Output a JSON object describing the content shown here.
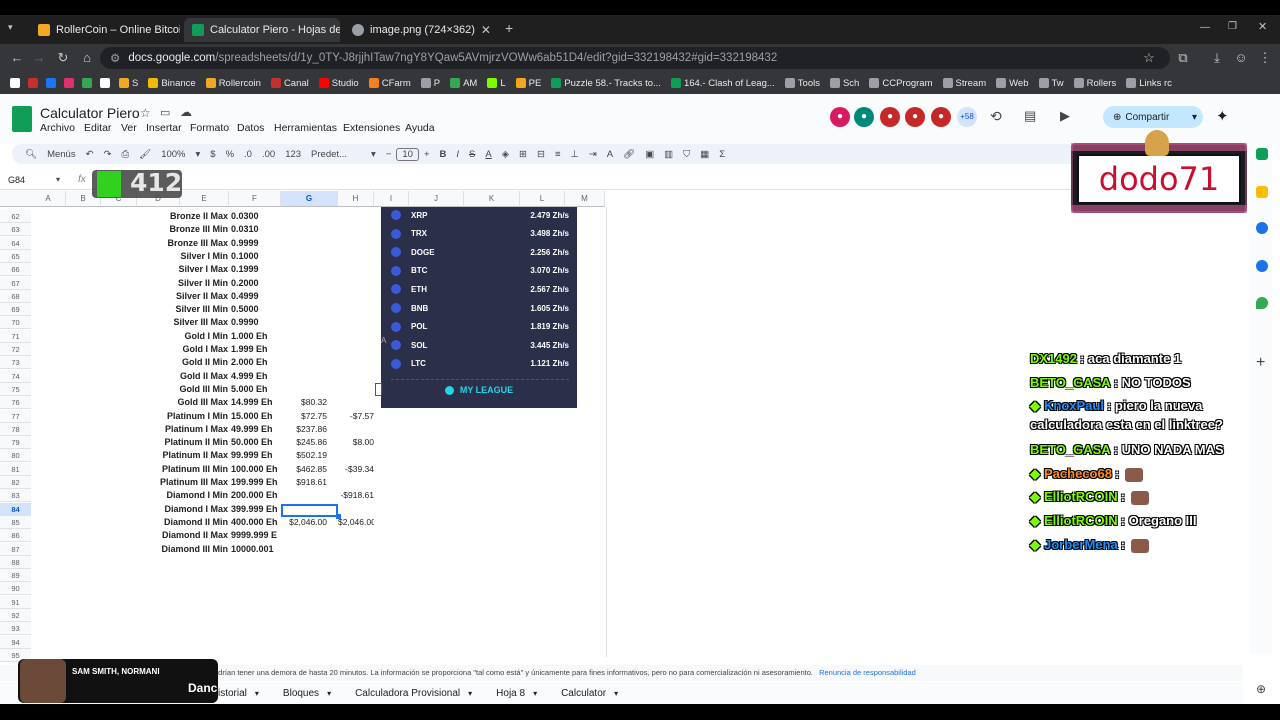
{
  "browser": {
    "tabs": [
      {
        "title": "RollerCoin – Online Bitcoin Mi",
        "color": "#f5a623"
      },
      {
        "title": "Calculator Piero - Hojas de cálc",
        "color": "#0f9d58"
      },
      {
        "title": "image.png (724×362)",
        "color": "#9aa0a6"
      }
    ],
    "url_main": "docs.google.com",
    "url_rest": "/spreadsheets/d/1y_0TY-J8rjjhITaw7ngY8YQaw5AVmjrzVOWw6ab51D4/edit?gid=332198432#gid=332198432",
    "bookmarks": [
      "S",
      "Binance",
      "Rollercoin",
      "Canal",
      "Studio",
      "CFarm",
      "P",
      "AM",
      "L",
      "PE",
      "Puzzle 58.- Tracks to...",
      "164.- Clash of Leag...",
      "Tools",
      "Sch",
      "CCProgram",
      "Stream",
      "Web",
      "Tw",
      "Rollers",
      "Links rc"
    ]
  },
  "sheets": {
    "title": "Calculator Piero",
    "menu": [
      "Archivo",
      "Editar",
      "Ver",
      "Insertar",
      "Formato",
      "Datos",
      "Herramientas",
      "Extensiones",
      "Ayuda"
    ],
    "toolbar": {
      "search": "Menús",
      "zoom": "100%",
      "currency": "$",
      "percent": "%",
      "dec_less": ".0",
      "dec_more": ".00",
      "num": "123",
      "font": "Predet...",
      "size": "10"
    },
    "namebox": "G84",
    "fx": "fx",
    "share": "Compartir",
    "collab_extra": "+58",
    "columns": [
      "A",
      "B",
      "C",
      "D",
      "E",
      "F",
      "G",
      "H",
      "I",
      "J",
      "K",
      "L",
      "M"
    ],
    "rows": [
      {
        "n": "62",
        "e": "Bronze II Max",
        "f": "0.0300",
        "g": "",
        "h": ""
      },
      {
        "n": "63",
        "e": "Bronze III Min",
        "f": "0.0310",
        "g": "",
        "h": ""
      },
      {
        "n": "64",
        "e": "Bronze III Max",
        "f": "0.9999",
        "g": "",
        "h": ""
      },
      {
        "n": "65",
        "e": "Silver I Min",
        "f": "0.1000",
        "g": "",
        "h": ""
      },
      {
        "n": "66",
        "e": "Silver I Max",
        "f": "0.1999",
        "g": "",
        "h": ""
      },
      {
        "n": "67",
        "e": "Silver II Min",
        "f": "0.2000",
        "g": "",
        "h": ""
      },
      {
        "n": "68",
        "e": "Silver II Max",
        "f": "0.4999",
        "g": "",
        "h": ""
      },
      {
        "n": "69",
        "e": "Silver III Min",
        "f": "0.5000",
        "g": "",
        "h": ""
      },
      {
        "n": "70",
        "e": "Silver III Max",
        "f": "0.9990",
        "g": "",
        "h": ""
      },
      {
        "n": "71",
        "e": "Gold I Min",
        "f": "1.000 Eh",
        "g": "",
        "h": ""
      },
      {
        "n": "72",
        "e": "Gold I Max",
        "f": "1.999 Eh",
        "g": "",
        "h": ""
      },
      {
        "n": "73",
        "e": "Gold II Min",
        "f": "2.000 Eh",
        "g": "",
        "h": ""
      },
      {
        "n": "74",
        "e": "Gold II Max",
        "f": "4.999 Eh",
        "g": "",
        "h": ""
      },
      {
        "n": "75",
        "e": "Gold III Min",
        "f": "5.000 Eh",
        "g": "",
        "h": ""
      },
      {
        "n": "76",
        "e": "Gold III Max",
        "f": "14.999 Eh",
        "g": "$80.32",
        "h": ""
      },
      {
        "n": "77",
        "e": "Platinum I Min",
        "f": "15.000 Eh",
        "g": "$72.75",
        "h": "-$7.57"
      },
      {
        "n": "78",
        "e": "Platinum I Max",
        "f": "49.999 Eh",
        "g": "$237.86",
        "h": ""
      },
      {
        "n": "79",
        "e": "Platinum II Min",
        "f": "50.000 Eh",
        "g": "$245.86",
        "h": "$8.00"
      },
      {
        "n": "80",
        "e": "Platinum II Max",
        "f": "99.999 Eh",
        "g": "$502.19",
        "h": ""
      },
      {
        "n": "81",
        "e": "Platinum III Min",
        "f": "100.000 Eh",
        "g": "$462.85",
        "h": "-$39.34"
      },
      {
        "n": "82",
        "e": "Platinum III Max",
        "f": "199.999 Eh",
        "g": "$918.61",
        "h": ""
      },
      {
        "n": "83",
        "e": "Diamond I Min",
        "f": "200.000 Eh",
        "g": "",
        "h": "-$918.61"
      },
      {
        "n": "84",
        "e": "Diamond I Max",
        "f": "399.999 Eh",
        "g": "",
        "h": ""
      },
      {
        "n": "85",
        "e": "Diamond II Min",
        "f": "400.000 Eh",
        "g": "$2,046.00",
        "h": "$2,046.00"
      },
      {
        "n": "86",
        "e": "Diamond II Max",
        "f": "9999.999 E",
        "g": "",
        "h": ""
      },
      {
        "n": "87",
        "e": "Diamond III Min",
        "f": "10000.001",
        "g": "",
        "h": ""
      },
      {
        "n": "88",
        "e": "",
        "f": "",
        "g": "",
        "h": ""
      },
      {
        "n": "89",
        "e": "",
        "f": "",
        "g": "",
        "h": ""
      },
      {
        "n": "90",
        "e": "",
        "f": "",
        "g": "",
        "h": ""
      },
      {
        "n": "91",
        "e": "",
        "f": "",
        "g": "",
        "h": ""
      },
      {
        "n": "92",
        "e": "",
        "f": "",
        "g": "",
        "h": ""
      },
      {
        "n": "93",
        "e": "",
        "f": "",
        "g": "",
        "h": ""
      },
      {
        "n": "94",
        "e": "",
        "f": "",
        "g": "",
        "h": ""
      },
      {
        "n": "95",
        "e": "",
        "f": "",
        "g": "",
        "h": ""
      }
    ],
    "league": {
      "coins": [
        {
          "name": "XRP",
          "power": "2.479 Zh/s"
        },
        {
          "name": "TRX",
          "power": "3.498 Zh/s"
        },
        {
          "name": "DOGE",
          "power": "2.256 Zh/s"
        },
        {
          "name": "BTC",
          "power": "3.070 Zh/s"
        },
        {
          "name": "ETH",
          "power": "2.567 Zh/s"
        },
        {
          "name": "BNB",
          "power": "1.605 Zh/s"
        },
        {
          "name": "POL",
          "power": "1.819 Zh/s"
        },
        {
          "name": "SOL",
          "power": "3.445 Zh/s"
        },
        {
          "name": "LTC",
          "power": "1.121 Zh/s"
        }
      ],
      "button": "MY LEAGUE"
    },
    "disclaimer": "odrían tener una demora de hasta 20 minutos. La información se proporciona \"tal como está\" y únicamente para fines informativos, pero no para comercialización ni asesoramiento.",
    "disclaimer_link": "Renuncia de responsabilidad",
    "sheet_tabs": [
      "istorial",
      "Bloques",
      "Calculadora Provisional",
      "Hoja 8",
      "Calculator"
    ]
  },
  "overlay": {
    "score": "412",
    "streamer": "dodo71",
    "music_artist": "SAM SMITH, NORMANI",
    "music_title": "Danc",
    "chat": [
      {
        "user": "DX1492",
        "msg": ": aca diamante 1",
        "color": "#7cfc00"
      },
      {
        "user": "BETO_GASA",
        "msg": ": NO TODOS",
        "color": "#7cfc00"
      },
      {
        "user": "KnoxPaul",
        "msg": ": piero la nueva",
        "msg2": "calculadora esta en el linktree?",
        "color": "#1e90ff"
      },
      {
        "user": "BETO_GASA",
        "msg": ": UNO NADA MAS",
        "color": "#7cfc00"
      },
      {
        "user": "Pacheco68",
        "msg": ":",
        "color": "#ff8c1a"
      },
      {
        "user": "ElliotRCOIN",
        "msg": ":",
        "color": "#7cfc00"
      },
      {
        "user": "ElliotRCOIN",
        "msg": ": Oregano III",
        "color": "#7cfc00"
      },
      {
        "user": "JorberMena",
        "msg": ":",
        "color": "#1e90ff"
      }
    ]
  }
}
